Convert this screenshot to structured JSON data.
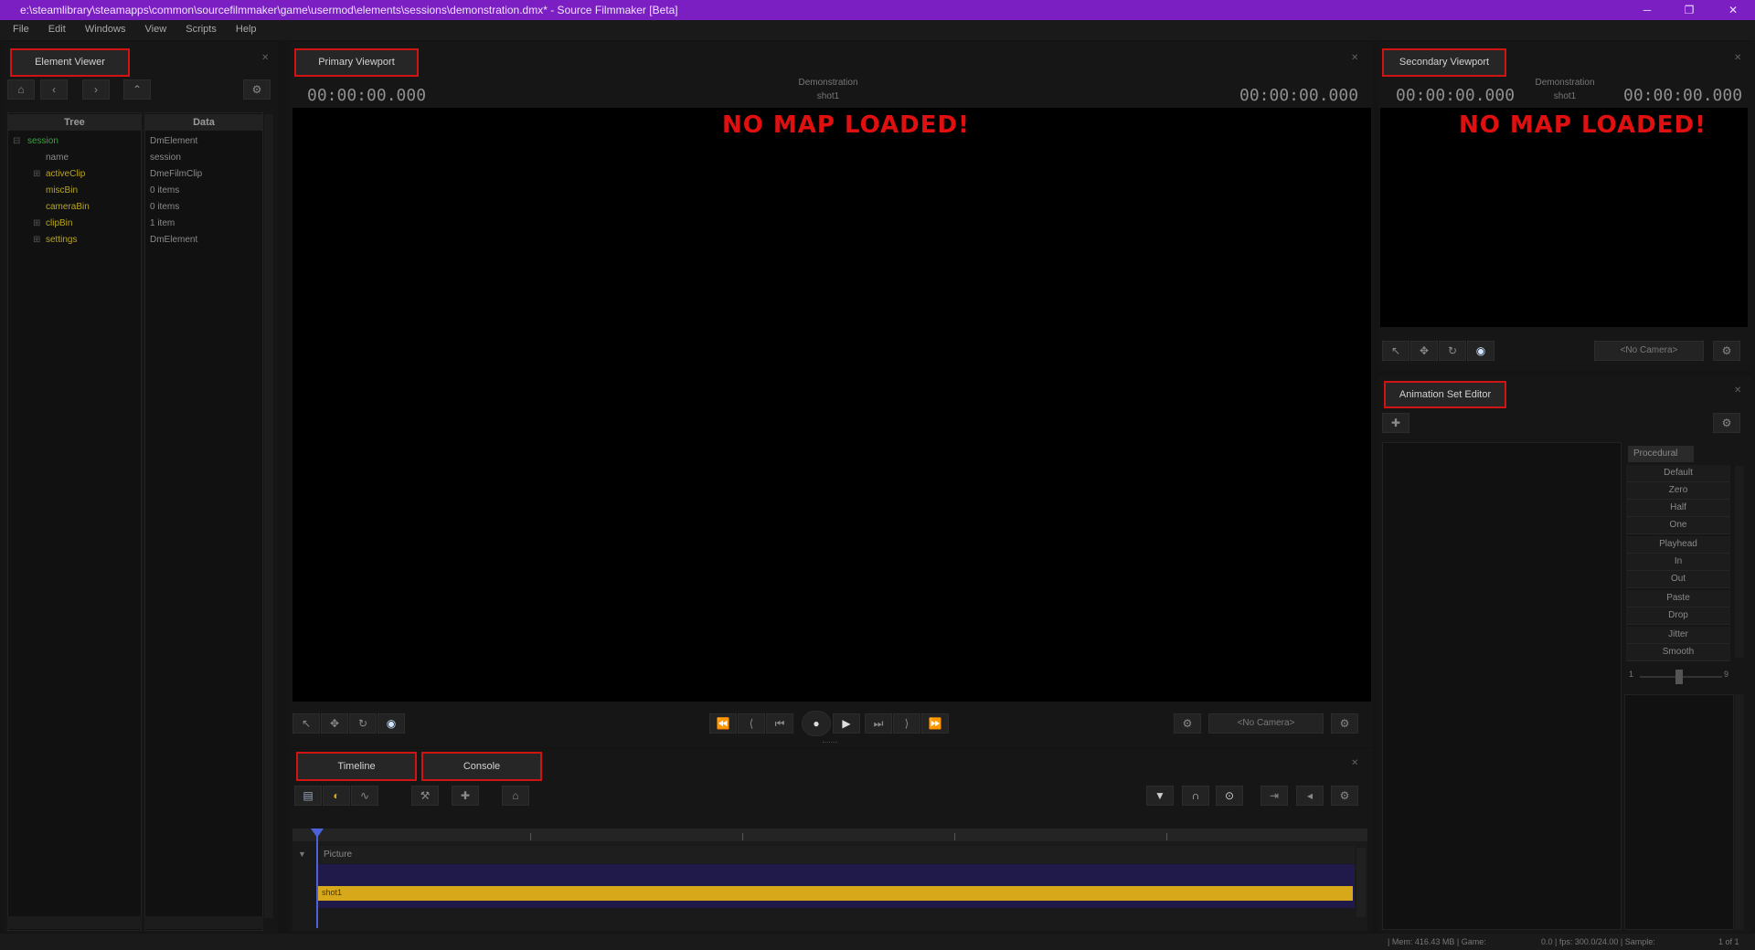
{
  "titlebar": {
    "title": "e:\\steamlibrary\\steamapps\\common\\sourcefilmmaker\\game\\usermod\\elements\\sessions\\demonstration.dmx* - Source Filmmaker [Beta]",
    "minimize": "─",
    "maximize": "❐",
    "close": "✕"
  },
  "menu": [
    "File",
    "Edit",
    "Windows",
    "View",
    "Scripts",
    "Help"
  ],
  "element_viewer": {
    "tab": "Element Viewer",
    "col_tree": "Tree",
    "col_data": "Data",
    "tree": [
      "session",
      "name",
      "activeClip",
      "miscBin",
      "cameraBin",
      "clipBin",
      "settings"
    ],
    "data": [
      "DmElement",
      "session",
      "DmeFilmClip",
      "0 items",
      "0 items",
      "1 item",
      "DmElement"
    ]
  },
  "primary_viewport": {
    "tab": "Primary Viewport",
    "timecode_left": "00:00:00.000",
    "timecode_right": "00:00:00.000",
    "session_name": "Demonstration",
    "shot_name": "shot1",
    "no_map": "NO MAP LOADED!",
    "camera_select": "<No Camera>"
  },
  "secondary_viewport": {
    "tab": "Secondary Viewport",
    "timecode_left": "00:00:00.000",
    "timecode_right": "00:00:00.000",
    "session_name": "Demonstration",
    "shot_name": "shot1",
    "no_map": "NO MAP LOADED!",
    "camera_select": "<No Camera>"
  },
  "animation_set_editor": {
    "tab": "Animation Set Editor",
    "procedural_label": "Procedural",
    "buttons": [
      "Default",
      "Zero",
      "Half",
      "One",
      "Playhead",
      "In",
      "Out",
      "Paste",
      "Drop",
      "Jitter",
      "Smooth"
    ],
    "slider_min": "1",
    "slider_max": "9"
  },
  "bottom_tabs": {
    "timeline": "Timeline",
    "console": "Console"
  },
  "timeline": {
    "track_label": "Picture",
    "clip_label": "shot1"
  },
  "statusbar": {
    "mem": "| Mem: 416.43 MB | Game:",
    "fps": "0.0 | fps: 300.0/24.00 | Sample:",
    "pages": "1 of 1"
  },
  "colors": {
    "titlebar": "#7c1fc2",
    "tab_highlight": "#d01414",
    "no_map": "#e01010",
    "clip_bar": "#d7a91a"
  }
}
